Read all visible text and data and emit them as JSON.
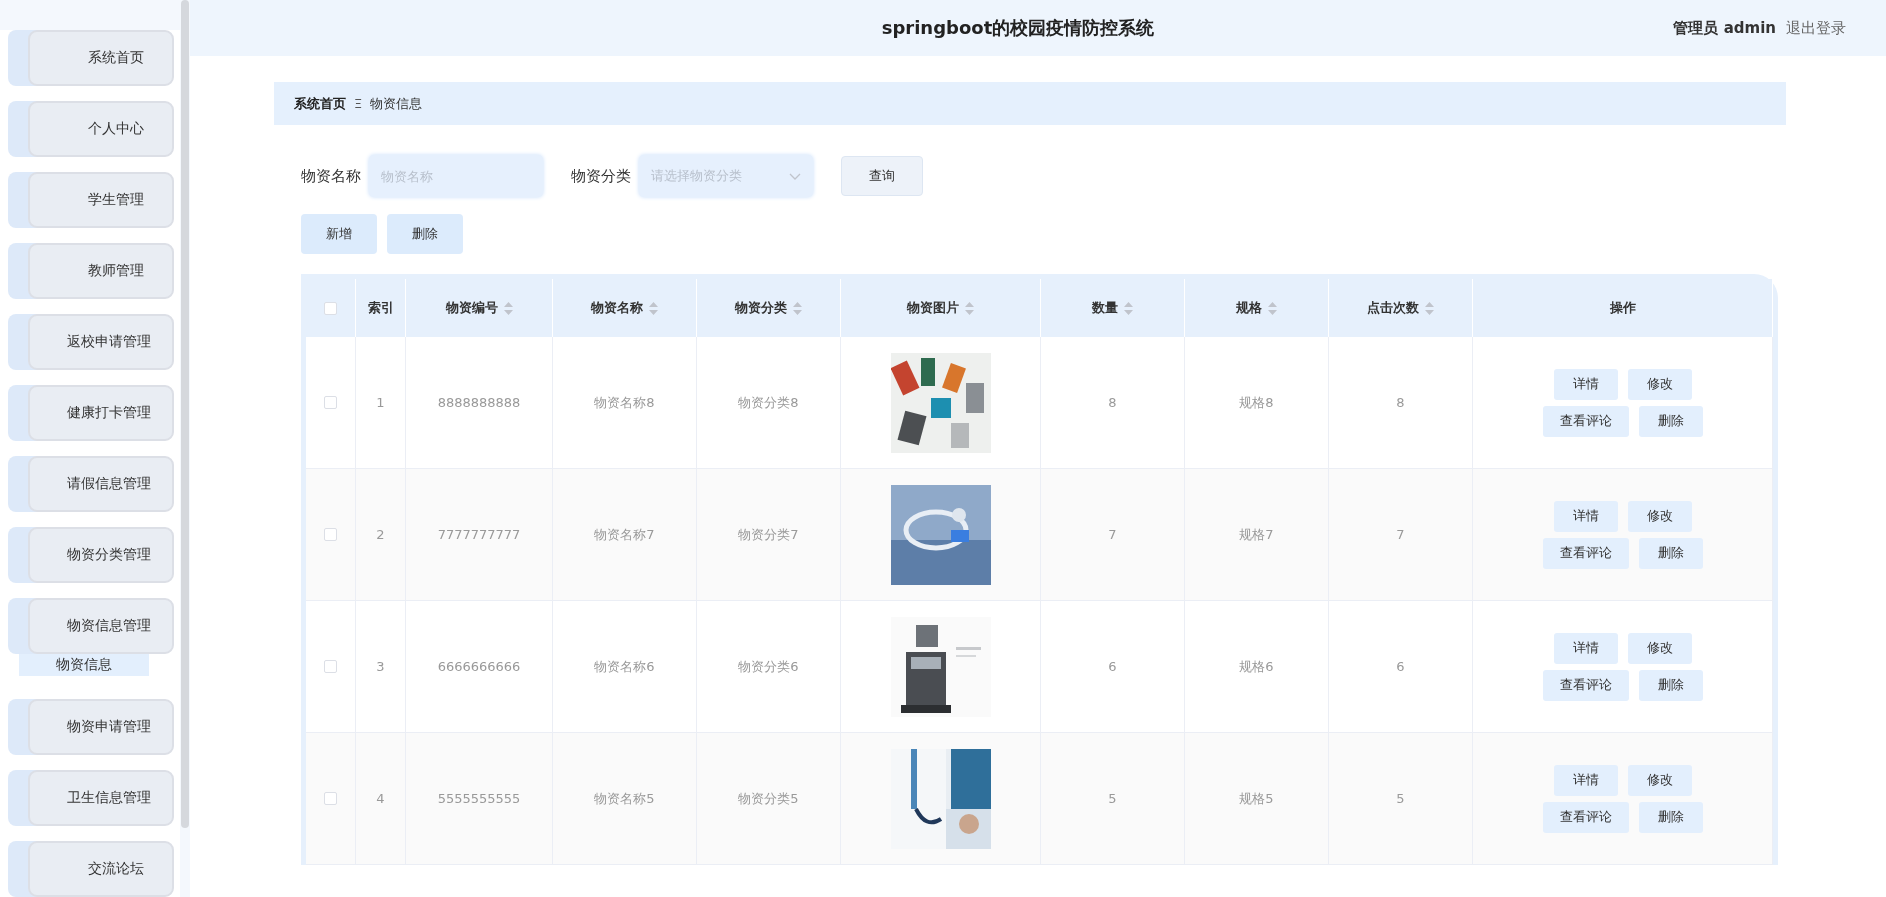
{
  "header": {
    "title": "springboot的校园疫情防控系统",
    "user": "管理员 admin",
    "logout": "退出登录"
  },
  "sidebar": {
    "items": [
      {
        "label": "系统首页"
      },
      {
        "label": "个人中心"
      },
      {
        "label": "学生管理"
      },
      {
        "label": "教师管理"
      },
      {
        "label": "返校申请管理"
      },
      {
        "label": "健康打卡管理"
      },
      {
        "label": "请假信息管理"
      },
      {
        "label": "物资分类管理"
      },
      {
        "label": "物资信息管理",
        "children": [
          {
            "label": "物资信息",
            "selected": true
          }
        ]
      },
      {
        "label": "物资申请管理"
      },
      {
        "label": "卫生信息管理"
      },
      {
        "label": "交流论坛"
      }
    ]
  },
  "breadcrumb": {
    "home": "系统首页",
    "separator": "Ξ",
    "current": "物资信息"
  },
  "search": {
    "fields": [
      {
        "kind": "input",
        "label": "物资名称",
        "placeholder": "物资名称"
      },
      {
        "kind": "select",
        "label": "物资分类",
        "placeholder": "请选择物资分类"
      }
    ],
    "query_button": "查询"
  },
  "actions": [
    "新增",
    "删除"
  ],
  "table": {
    "header_checked": false,
    "columns": [
      {
        "label": "索引",
        "sortable": false
      },
      {
        "label": "物资编号",
        "sortable": true
      },
      {
        "label": "物资名称",
        "sortable": true
      },
      {
        "label": "物资分类",
        "sortable": true
      },
      {
        "label": "物资图片",
        "sortable": true
      },
      {
        "label": "数量",
        "sortable": true
      },
      {
        "label": "规格",
        "sortable": true
      },
      {
        "label": "点击次数",
        "sortable": true
      },
      {
        "label": "操作",
        "sortable": false
      }
    ],
    "rows": [
      {
        "checked": false,
        "index": "1",
        "code": "8888888888",
        "name": "物资名称8",
        "category": "物资分类8",
        "quantity": "8",
        "spec": "规格8",
        "clicks": "8",
        "buttons": [
          "详情",
          "修改",
          "查看评论",
          "删除"
        ]
      },
      {
        "checked": false,
        "index": "2",
        "code": "7777777777",
        "name": "物资名称7",
        "category": "物资分类7",
        "quantity": "7",
        "spec": "规格7",
        "clicks": "7",
        "buttons": [
          "详情",
          "修改",
          "查看评论",
          "删除"
        ]
      },
      {
        "checked": false,
        "index": "3",
        "code": "6666666666",
        "name": "物资名称6",
        "category": "物资分类6",
        "quantity": "6",
        "spec": "规格6",
        "clicks": "6",
        "buttons": [
          "详情",
          "修改",
          "查看评论",
          "删除"
        ]
      },
      {
        "checked": false,
        "index": "4",
        "code": "5555555555",
        "name": "物资名称5",
        "category": "物资分类5",
        "quantity": "5",
        "spec": "规格5",
        "clicks": "5",
        "buttons": [
          "详情",
          "修改",
          "查看评论",
          "删除"
        ]
      }
    ]
  }
}
